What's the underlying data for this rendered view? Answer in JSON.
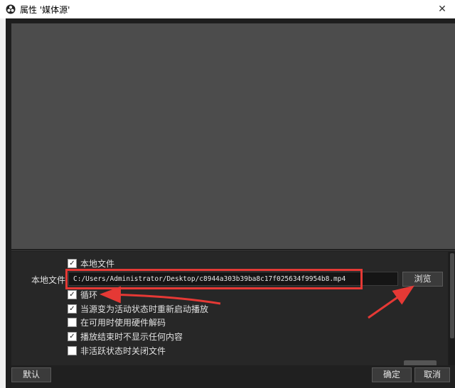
{
  "window": {
    "title": "属性 '媒体源'",
    "app_icon": "obs-logo-icon",
    "close_glyph": "✕"
  },
  "properties": {
    "local_file_checkbox": {
      "label": "本地文件",
      "checked": true
    },
    "local_file_field": {
      "label": "本地文件",
      "value": "C:/Users/Administrator/Desktop/c8944a303b39ba8c17f025634f9954b8.mp4"
    },
    "browse_button": "浏览",
    "options": [
      {
        "label": "循环",
        "checked": true
      },
      {
        "label": "当源变为活动状态时重新启动播放",
        "checked": true
      },
      {
        "label": "在可用时使用硬件解码",
        "checked": false
      },
      {
        "label": "播放结束时不显示任何内容",
        "checked": true
      },
      {
        "label": "非活跃状态时关闭文件",
        "checked": false
      }
    ],
    "check_glyph": "✓"
  },
  "footer": {
    "default_button": "默认",
    "ok_button": "确定",
    "cancel_button": "取消"
  },
  "annotation": {
    "color": "#e53935"
  }
}
